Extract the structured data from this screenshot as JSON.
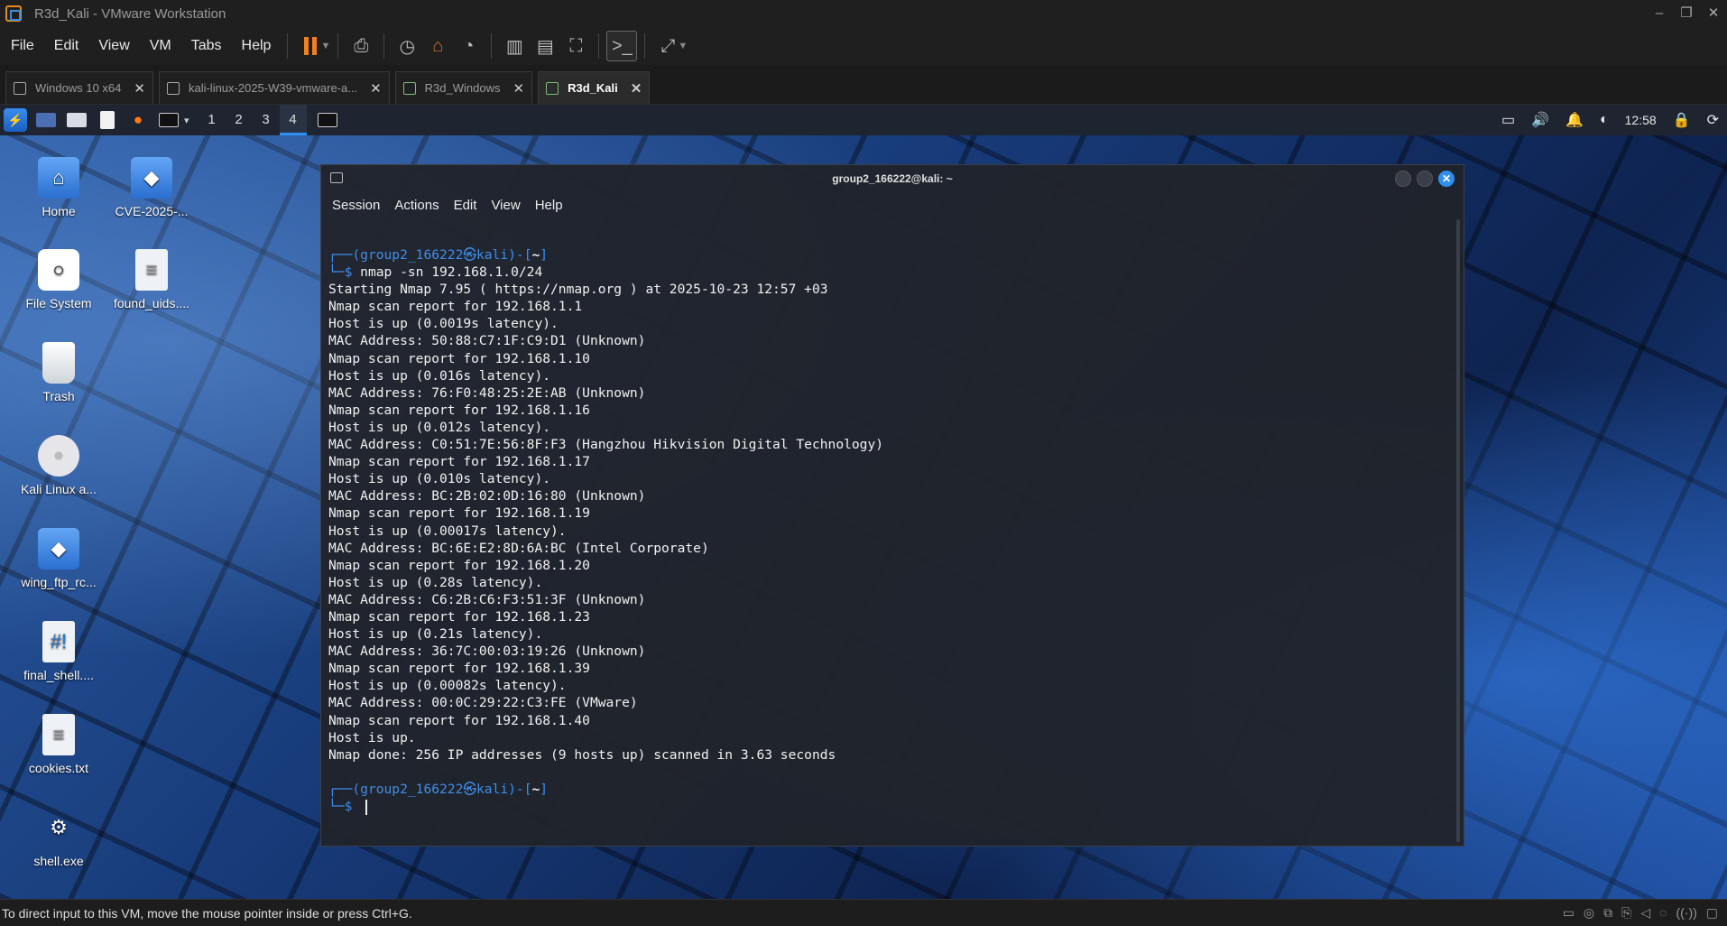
{
  "window": {
    "title": "R3d_Kali - VMware Workstation"
  },
  "menubar": {
    "items": [
      "File",
      "Edit",
      "View",
      "VM",
      "Tabs",
      "Help"
    ]
  },
  "tabs": [
    {
      "label": "Windows 10 x64",
      "active": false
    },
    {
      "label": "kali-linux-2025-W39-vmware-a...",
      "active": false
    },
    {
      "label": "R3d_Windows",
      "active": false
    },
    {
      "label": "R3d_Kali",
      "active": true
    }
  ],
  "panel": {
    "workspaces": [
      "1",
      "2",
      "3",
      "4"
    ],
    "active_workspace": "4",
    "clock": "12:58"
  },
  "desktop_icons": [
    {
      "label": "Home",
      "icon": "home-folder-icon"
    },
    {
      "label": "CVE-2025-...",
      "icon": "python-file-icon"
    },
    {
      "label": "File System",
      "icon": "drive-icon"
    },
    {
      "label": "found_uids....",
      "icon": "text-file-icon"
    },
    {
      "label": "Trash",
      "icon": "trash-icon"
    },
    {
      "label": "Kali Linux a...",
      "icon": "cd-icon"
    },
    {
      "label": "wing_ftp_rc...",
      "icon": "python-file-icon"
    },
    {
      "label": "final_shell....",
      "icon": "script-file-icon"
    },
    {
      "label": "cookies.txt",
      "icon": "text-file-icon"
    },
    {
      "label": "shell.exe",
      "icon": "gear-icon"
    }
  ],
  "terminal": {
    "title": "group2_166222@kali: ~",
    "menu": [
      "Session",
      "Actions",
      "Edit",
      "View",
      "Help"
    ],
    "prompt": {
      "user": "group2_166222",
      "at": "㉿",
      "host": "kali",
      "dir": "~"
    },
    "command": "nmap -sn 192.168.1.0/24",
    "output": [
      "Starting Nmap 7.95 ( https://nmap.org ) at 2025-10-23 12:57 +03",
      "Nmap scan report for 192.168.1.1",
      "Host is up (0.0019s latency).",
      "MAC Address: 50:88:C7:1F:C9:D1 (Unknown)",
      "Nmap scan report for 192.168.1.10",
      "Host is up (0.016s latency).",
      "MAC Address: 76:F0:48:25:2E:AB (Unknown)",
      "Nmap scan report for 192.168.1.16",
      "Host is up (0.012s latency).",
      "MAC Address: C0:51:7E:56:8F:F3 (Hangzhou Hikvision Digital Technology)",
      "Nmap scan report for 192.168.1.17",
      "Host is up (0.010s latency).",
      "MAC Address: BC:2B:02:0D:16:80 (Unknown)",
      "Nmap scan report for 192.168.1.19",
      "Host is up (0.00017s latency).",
      "MAC Address: BC:6E:E2:8D:6A:BC (Intel Corporate)",
      "Nmap scan report for 192.168.1.20",
      "Host is up (0.28s latency).",
      "MAC Address: C6:2B:C6:F3:51:3F (Unknown)",
      "Nmap scan report for 192.168.1.23",
      "Host is up (0.21s latency).",
      "MAC Address: 36:7C:00:03:19:26 (Unknown)",
      "Nmap scan report for 192.168.1.39",
      "Host is up (0.00082s latency).",
      "MAC Address: 00:0C:29:22:C3:FE (VMware)",
      "Nmap scan report for 192.168.1.40",
      "Host is up.",
      "Nmap done: 256 IP addresses (9 hosts up) scanned in 3.63 seconds"
    ]
  },
  "statusbar": {
    "message": "To direct input to this VM, move the mouse pointer inside or press Ctrl+G."
  },
  "colors": {
    "accent": "#2f8ef0",
    "pause": "#f0821e",
    "prompt": "#3f8eea"
  }
}
